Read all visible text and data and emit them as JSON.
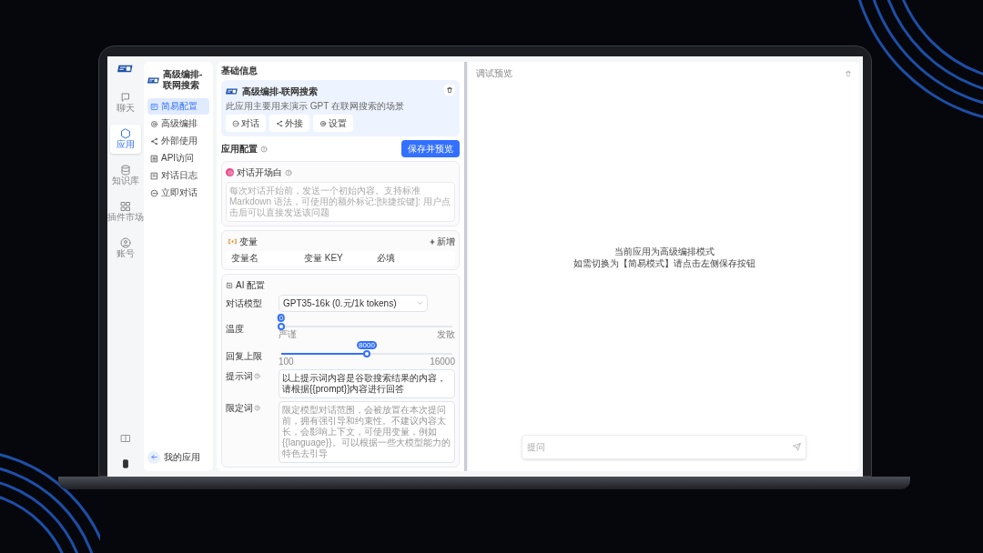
{
  "left_nav": {
    "items": [
      {
        "label": "聊天",
        "selected": false
      },
      {
        "label": "应用",
        "selected": true
      },
      {
        "label": "知识库",
        "selected": false
      },
      {
        "label": "插件市场",
        "selected": false
      },
      {
        "label": "账号",
        "selected": false
      }
    ]
  },
  "app_menu": {
    "app_name": "高级编排-联网搜索",
    "items": [
      {
        "label": "简易配置",
        "selected": true
      },
      {
        "label": "高级编排",
        "selected": false
      },
      {
        "label": "外部使用",
        "selected": false
      },
      {
        "label": "API访问",
        "selected": false
      },
      {
        "label": "对话日志",
        "selected": false
      },
      {
        "label": "立即对话",
        "selected": false
      }
    ],
    "back": "我的应用"
  },
  "basic_info": {
    "heading": "基础信息",
    "app_name": "高级编排-联网搜索",
    "description": "此应用主要用来演示 GPT 在联网搜索的场景",
    "buttons": [
      "对话",
      "外接",
      "设置"
    ]
  },
  "app_config": {
    "heading": "应用配置",
    "save_button": "保存并预览"
  },
  "opening": {
    "title": "对话开场白",
    "placeholder": "每次对话开始前，发送一个初始内容。支持标准 Markdown 语法，可使用的额外标记:[快捷按键]: 用户点击后可以直接发送该问题"
  },
  "variables": {
    "title": "变量",
    "add_button": "新增",
    "columns": [
      "变量名",
      "变量 KEY",
      "必填"
    ]
  },
  "ai_config": {
    "title": "AI 配置",
    "model_label": "对话模型",
    "model": "GPT35-16k (0.元/1k tokens)",
    "temperature": {
      "label": "温度",
      "value": "0",
      "level": 0,
      "min_label": "严谨",
      "max_label": "发散"
    },
    "max_tokens": {
      "label": "回复上限",
      "value": "8000",
      "level": 0.5,
      "min_label": "100",
      "max_label": "16000"
    },
    "prompt": {
      "label": "提示词",
      "value": "以上提示词内容是谷歌搜索结果的内容，请根据{{prompt}}内容进行回答"
    },
    "limit": {
      "label": "限定词",
      "placeholder": "限定模型对话范围，会被放置在本次提问前，拥有强引导和约束性。不建议内容太长，会影响上下文，可使用变量，例如 {{language}}。可以根据一些大模型能力的特色去引导"
    }
  },
  "preview": {
    "title": "调试预览",
    "message_lines": [
      "当前应用为高级编排模式",
      "如需切换为【简易模式】请点击左侧保存按钮"
    ],
    "input_placeholder": "提问"
  }
}
